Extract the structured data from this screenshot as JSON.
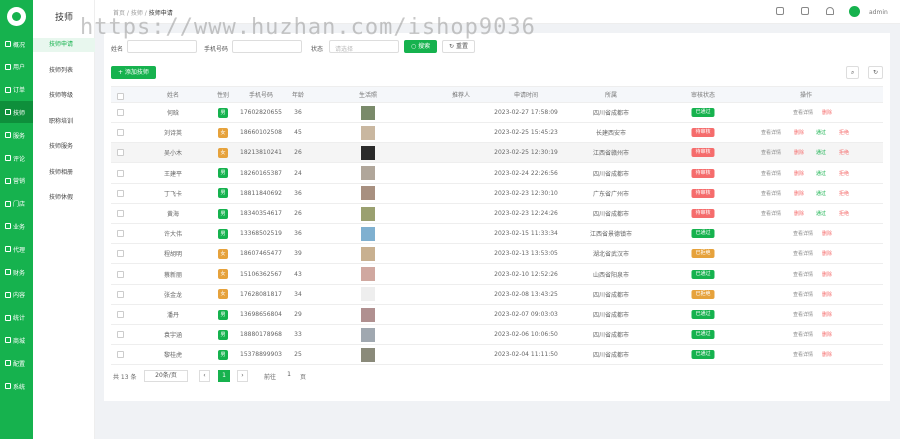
{
  "sidebar": {
    "items": [
      {
        "label": "概况",
        "icon": "home-icon"
      },
      {
        "label": "用户",
        "icon": "user-icon"
      },
      {
        "label": "订单",
        "icon": "order-icon"
      },
      {
        "label": "技师",
        "icon": "technician-icon"
      },
      {
        "label": "服务",
        "icon": "service-icon"
      },
      {
        "label": "评论",
        "icon": "comment-icon"
      },
      {
        "label": "营销",
        "icon": "marketing-icon"
      },
      {
        "label": "门店",
        "icon": "store-icon"
      },
      {
        "label": "业务",
        "icon": "business-icon"
      },
      {
        "label": "代理",
        "icon": "agent-icon"
      },
      {
        "label": "财务",
        "icon": "finance-icon"
      },
      {
        "label": "内容",
        "icon": "content-icon"
      },
      {
        "label": "统计",
        "icon": "stats-icon"
      },
      {
        "label": "商城",
        "icon": "mall-icon"
      },
      {
        "label": "配置",
        "icon": "config-icon"
      },
      {
        "label": "系统",
        "icon": "system-icon"
      }
    ],
    "active": 3
  },
  "submenu": {
    "title": "技师",
    "items": [
      "技师申请",
      "技师列表",
      "技师等级",
      "职称培训",
      "技师服务",
      "技师相册",
      "技师休假"
    ],
    "active": 0
  },
  "header": {
    "breadcrumb": [
      "首页",
      "技师",
      "技师申请"
    ],
    "user": "admin"
  },
  "filters": {
    "name_label": "姓名",
    "phone_label": "手机号码",
    "status_label": "状态",
    "status_placeholder": "请选择",
    "search_button": "搜索",
    "reset_button": "重置"
  },
  "toolbar": {
    "add_button": "+ 添加技师"
  },
  "table": {
    "columns": [
      "",
      "姓名",
      "性别",
      "手机号码",
      "年龄",
      "生活照",
      "推荐人",
      "申请时间",
      "所属",
      "审核状态",
      "操作"
    ],
    "rows": [
      {
        "name": "何晗",
        "gender": "男",
        "phone": "17602820655",
        "age": "36",
        "referrer": "",
        "time": "2023-02-27 17:58:09",
        "region": "四川省成都市",
        "status": "已通过",
        "ops": [
          "查看详情",
          "删除"
        ]
      },
      {
        "name": "刘诗英",
        "gender": "女",
        "phone": "18660102508",
        "age": "45",
        "referrer": "",
        "time": "2023-02-25 15:45:23",
        "region": "长建西安市",
        "status": "待审核",
        "ops": [
          "查看详情",
          "删除",
          "通过",
          "拒绝"
        ]
      },
      {
        "name": "吴小木",
        "gender": "女",
        "phone": "18213810241",
        "age": "26",
        "referrer": "",
        "time": "2023-02-25 12:30:19",
        "region": "江西省赣州市",
        "status": "待审核",
        "ops": [
          "查看详情",
          "删除",
          "通过",
          "拒绝"
        ]
      },
      {
        "name": "王建平",
        "gender": "男",
        "phone": "18260165387",
        "age": "24",
        "referrer": "",
        "time": "2023-02-24 22:26:56",
        "region": "四川省成都市",
        "status": "待审核",
        "ops": [
          "查看详情",
          "删除",
          "通过",
          "拒绝"
        ]
      },
      {
        "name": "丁飞卡",
        "gender": "男",
        "phone": "18811840692",
        "age": "36",
        "referrer": "",
        "time": "2023-02-23 12:30:10",
        "region": "广东省广州市",
        "status": "待审核",
        "ops": [
          "查看详情",
          "删除",
          "通过",
          "拒绝"
        ]
      },
      {
        "name": "黄海",
        "gender": "男",
        "phone": "18340354617",
        "age": "26",
        "referrer": "",
        "time": "2023-02-23 12:24:26",
        "region": "四川省成都市",
        "status": "待审核",
        "ops": [
          "查看详情",
          "删除",
          "通过",
          "拒绝"
        ]
      },
      {
        "name": "许大伟",
        "gender": "男",
        "phone": "13368502519",
        "age": "36",
        "referrer": "",
        "time": "2023-02-15 11:33:34",
        "region": "江西省景德镇市",
        "status": "已通过",
        "ops": [
          "查看详情",
          "删除"
        ]
      },
      {
        "name": "程胡明",
        "gender": "女",
        "phone": "18607465477",
        "age": "39",
        "referrer": "",
        "time": "2023-02-13 13:53:05",
        "region": "湖北省武汉市",
        "status": "已拒绝",
        "ops": [
          "查看详情",
          "删除"
        ]
      },
      {
        "name": "蔡新丽",
        "gender": "女",
        "phone": "15106362567",
        "age": "43",
        "referrer": "",
        "time": "2023-02-10 12:52:26",
        "region": "山西省阳泉市",
        "status": "已通过",
        "ops": [
          "查看详情",
          "删除"
        ]
      },
      {
        "name": "张金龙",
        "gender": "女",
        "phone": "17628081817",
        "age": "34",
        "referrer": "",
        "time": "2023-02-08 13:43:25",
        "region": "四川省成都市",
        "status": "已拒绝",
        "ops": [
          "查看详情",
          "删除"
        ]
      },
      {
        "name": "潘丹",
        "gender": "男",
        "phone": "13698656804",
        "age": "29",
        "referrer": "",
        "time": "2023-02-07 09:03:03",
        "region": "四川省成都市",
        "status": "已通过",
        "ops": [
          "查看详情",
          "删除"
        ]
      },
      {
        "name": "袁宇涵",
        "gender": "男",
        "phone": "18880178968",
        "age": "33",
        "referrer": "",
        "time": "2023-02-06 10:06:50",
        "region": "四川省成都市",
        "status": "已通过",
        "ops": [
          "查看详情",
          "删除"
        ]
      },
      {
        "name": "黎桂虎",
        "gender": "男",
        "phone": "15378899903",
        "age": "25",
        "referrer": "",
        "time": "2023-02-04 11:11:50",
        "region": "四川省成都市",
        "status": "已通过",
        "ops": [
          "查看详情",
          "删除"
        ]
      }
    ]
  },
  "pagination": {
    "total": "共 13 条",
    "page_size": "20条/页",
    "current": "1",
    "goto_label": "前往",
    "goto_value": "1",
    "page_unit": "页"
  },
  "colors": {
    "brand": "#16b24e",
    "pending": "#f56c6c",
    "rejected": "#e6a23c",
    "approved": "#16b24e"
  },
  "watermark": "https://www.huzhan.com/ishop9036"
}
